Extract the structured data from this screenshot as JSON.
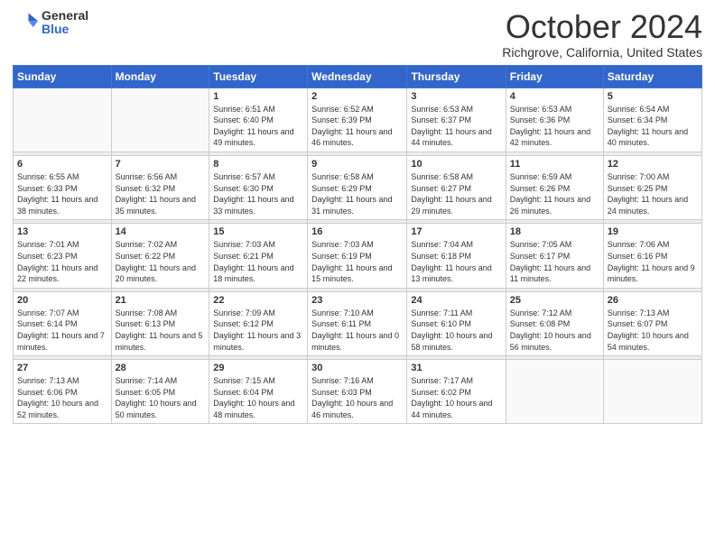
{
  "logo": {
    "general": "General",
    "blue": "Blue"
  },
  "header": {
    "month": "October 2024",
    "location": "Richgrove, California, United States"
  },
  "weekdays": [
    "Sunday",
    "Monday",
    "Tuesday",
    "Wednesday",
    "Thursday",
    "Friday",
    "Saturday"
  ],
  "weeks": [
    [
      {
        "day": "",
        "info": ""
      },
      {
        "day": "",
        "info": ""
      },
      {
        "day": "1",
        "info": "Sunrise: 6:51 AM\nSunset: 6:40 PM\nDaylight: 11 hours and 49 minutes."
      },
      {
        "day": "2",
        "info": "Sunrise: 6:52 AM\nSunset: 6:39 PM\nDaylight: 11 hours and 46 minutes."
      },
      {
        "day": "3",
        "info": "Sunrise: 6:53 AM\nSunset: 6:37 PM\nDaylight: 11 hours and 44 minutes."
      },
      {
        "day": "4",
        "info": "Sunrise: 6:53 AM\nSunset: 6:36 PM\nDaylight: 11 hours and 42 minutes."
      },
      {
        "day": "5",
        "info": "Sunrise: 6:54 AM\nSunset: 6:34 PM\nDaylight: 11 hours and 40 minutes."
      }
    ],
    [
      {
        "day": "6",
        "info": "Sunrise: 6:55 AM\nSunset: 6:33 PM\nDaylight: 11 hours and 38 minutes."
      },
      {
        "day": "7",
        "info": "Sunrise: 6:56 AM\nSunset: 6:32 PM\nDaylight: 11 hours and 35 minutes."
      },
      {
        "day": "8",
        "info": "Sunrise: 6:57 AM\nSunset: 6:30 PM\nDaylight: 11 hours and 33 minutes."
      },
      {
        "day": "9",
        "info": "Sunrise: 6:58 AM\nSunset: 6:29 PM\nDaylight: 11 hours and 31 minutes."
      },
      {
        "day": "10",
        "info": "Sunrise: 6:58 AM\nSunset: 6:27 PM\nDaylight: 11 hours and 29 minutes."
      },
      {
        "day": "11",
        "info": "Sunrise: 6:59 AM\nSunset: 6:26 PM\nDaylight: 11 hours and 26 minutes."
      },
      {
        "day": "12",
        "info": "Sunrise: 7:00 AM\nSunset: 6:25 PM\nDaylight: 11 hours and 24 minutes."
      }
    ],
    [
      {
        "day": "13",
        "info": "Sunrise: 7:01 AM\nSunset: 6:23 PM\nDaylight: 11 hours and 22 minutes."
      },
      {
        "day": "14",
        "info": "Sunrise: 7:02 AM\nSunset: 6:22 PM\nDaylight: 11 hours and 20 minutes."
      },
      {
        "day": "15",
        "info": "Sunrise: 7:03 AM\nSunset: 6:21 PM\nDaylight: 11 hours and 18 minutes."
      },
      {
        "day": "16",
        "info": "Sunrise: 7:03 AM\nSunset: 6:19 PM\nDaylight: 11 hours and 15 minutes."
      },
      {
        "day": "17",
        "info": "Sunrise: 7:04 AM\nSunset: 6:18 PM\nDaylight: 11 hours and 13 minutes."
      },
      {
        "day": "18",
        "info": "Sunrise: 7:05 AM\nSunset: 6:17 PM\nDaylight: 11 hours and 11 minutes."
      },
      {
        "day": "19",
        "info": "Sunrise: 7:06 AM\nSunset: 6:16 PM\nDaylight: 11 hours and 9 minutes."
      }
    ],
    [
      {
        "day": "20",
        "info": "Sunrise: 7:07 AM\nSunset: 6:14 PM\nDaylight: 11 hours and 7 minutes."
      },
      {
        "day": "21",
        "info": "Sunrise: 7:08 AM\nSunset: 6:13 PM\nDaylight: 11 hours and 5 minutes."
      },
      {
        "day": "22",
        "info": "Sunrise: 7:09 AM\nSunset: 6:12 PM\nDaylight: 11 hours and 3 minutes."
      },
      {
        "day": "23",
        "info": "Sunrise: 7:10 AM\nSunset: 6:11 PM\nDaylight: 11 hours and 0 minutes."
      },
      {
        "day": "24",
        "info": "Sunrise: 7:11 AM\nSunset: 6:10 PM\nDaylight: 10 hours and 58 minutes."
      },
      {
        "day": "25",
        "info": "Sunrise: 7:12 AM\nSunset: 6:08 PM\nDaylight: 10 hours and 56 minutes."
      },
      {
        "day": "26",
        "info": "Sunrise: 7:13 AM\nSunset: 6:07 PM\nDaylight: 10 hours and 54 minutes."
      }
    ],
    [
      {
        "day": "27",
        "info": "Sunrise: 7:13 AM\nSunset: 6:06 PM\nDaylight: 10 hours and 52 minutes."
      },
      {
        "day": "28",
        "info": "Sunrise: 7:14 AM\nSunset: 6:05 PM\nDaylight: 10 hours and 50 minutes."
      },
      {
        "day": "29",
        "info": "Sunrise: 7:15 AM\nSunset: 6:04 PM\nDaylight: 10 hours and 48 minutes."
      },
      {
        "day": "30",
        "info": "Sunrise: 7:16 AM\nSunset: 6:03 PM\nDaylight: 10 hours and 46 minutes."
      },
      {
        "day": "31",
        "info": "Sunrise: 7:17 AM\nSunset: 6:02 PM\nDaylight: 10 hours and 44 minutes."
      },
      {
        "day": "",
        "info": ""
      },
      {
        "day": "",
        "info": ""
      }
    ]
  ]
}
